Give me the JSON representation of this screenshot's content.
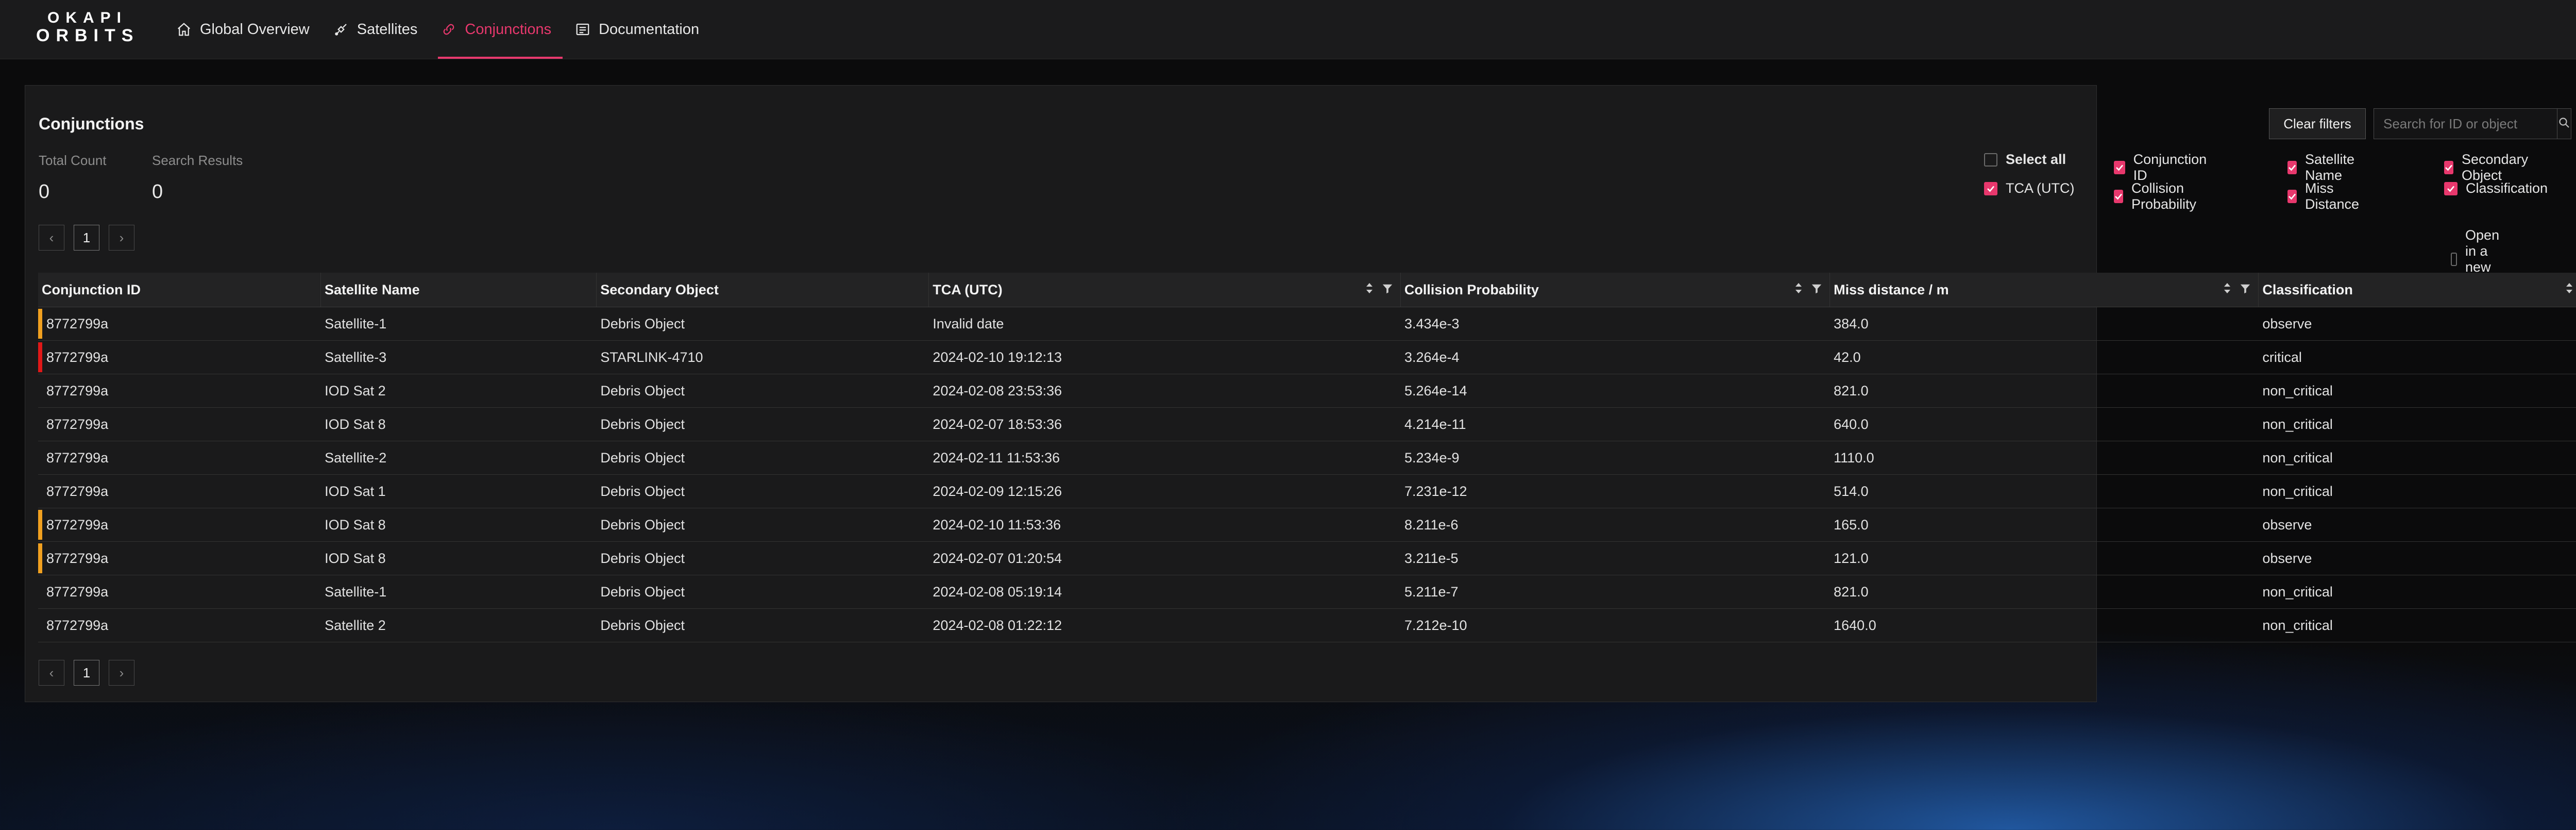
{
  "brand": {
    "line1": "OKAPI",
    "line2": "ORBITS"
  },
  "nav": [
    {
      "label": "Global Overview",
      "icon": "home-icon",
      "active": false
    },
    {
      "label": "Satellites",
      "icon": "satellite-icon",
      "active": false
    },
    {
      "label": "Conjunctions",
      "icon": "link-icon",
      "active": true
    },
    {
      "label": "Documentation",
      "icon": "book-icon",
      "active": false
    }
  ],
  "panel": {
    "title": "Conjunctions",
    "total_count_label": "Total Count",
    "total_count": "0",
    "search_results_label": "Search Results",
    "search_results": "0",
    "page": "1",
    "clear_filters": "Clear filters",
    "search_placeholder": "Search for ID or object",
    "search_value": ""
  },
  "columns_toggle": {
    "select_all": {
      "label": "Select all",
      "checked": false
    },
    "items": [
      {
        "label": "Conjunction ID",
        "checked": true
      },
      {
        "label": "Satellite Name",
        "checked": true
      },
      {
        "label": "Secondary Object",
        "checked": true
      },
      {
        "label": "TCA (UTC)",
        "checked": true
      },
      {
        "label": "Collision Probability",
        "checked": true
      },
      {
        "label": "Miss Distance",
        "checked": true
      },
      {
        "label": "Classification",
        "checked": true
      }
    ],
    "open_new_tab": {
      "label": "Open in a new tab",
      "checked": false
    }
  },
  "colors": {
    "accent": "#e8386d",
    "observe": "#f0a020",
    "critical": "#e01818"
  },
  "table": {
    "headers": [
      "Conjunction ID",
      "Satellite Name",
      "Secondary Object",
      "TCA (UTC)",
      "Collision Probability",
      "Miss distance / m",
      "Classification"
    ],
    "rows": [
      {
        "id": "8772799a",
        "sat": "Satellite-1",
        "secondary": "Debris Object",
        "tca": "Invalid date",
        "prob": "3.434e-3",
        "miss": "384.0",
        "cls": "observe"
      },
      {
        "id": "8772799a",
        "sat": "Satellite-3",
        "secondary": "STARLINK-4710",
        "tca": "2024-02-10 19:12:13",
        "prob": "3.264e-4",
        "miss": "42.0",
        "cls": "critical"
      },
      {
        "id": "8772799a",
        "sat": "IOD Sat 2",
        "secondary": "Debris Object",
        "tca": "2024-02-08 23:53:36",
        "prob": "5.264e-14",
        "miss": "821.0",
        "cls": "non_critical"
      },
      {
        "id": "8772799a",
        "sat": "IOD Sat 8",
        "secondary": "Debris Object",
        "tca": "2024-02-07 18:53:36",
        "prob": "4.214e-11",
        "miss": "640.0",
        "cls": "non_critical"
      },
      {
        "id": "8772799a",
        "sat": "Satellite-2",
        "secondary": "Debris Object",
        "tca": "2024-02-11 11:53:36",
        "prob": "5.234e-9",
        "miss": "1110.0",
        "cls": "non_critical"
      },
      {
        "id": "8772799a",
        "sat": "IOD Sat 1",
        "secondary": "Debris Object",
        "tca": "2024-02-09 12:15:26",
        "prob": "7.231e-12",
        "miss": "514.0",
        "cls": "non_critical"
      },
      {
        "id": "8772799a",
        "sat": "IOD Sat 8",
        "secondary": "Debris Object",
        "tca": "2024-02-10 11:53:36",
        "prob": "8.211e-6",
        "miss": "165.0",
        "cls": "observe"
      },
      {
        "id": "8772799a",
        "sat": "IOD Sat 8",
        "secondary": "Debris Object",
        "tca": "2024-02-07 01:20:54",
        "prob": "3.211e-5",
        "miss": "121.0",
        "cls": "observe"
      },
      {
        "id": "8772799a",
        "sat": "Satellite-1",
        "secondary": "Debris Object",
        "tca": "2024-02-08 05:19:14",
        "prob": "5.211e-7",
        "miss": "821.0",
        "cls": "non_critical"
      },
      {
        "id": "8772799a",
        "sat": "Satellite 2",
        "secondary": "Debris Object",
        "tca": "2024-02-08 01:22:12",
        "prob": "7.212e-10",
        "miss": "1640.0",
        "cls": "non_critical"
      }
    ]
  }
}
